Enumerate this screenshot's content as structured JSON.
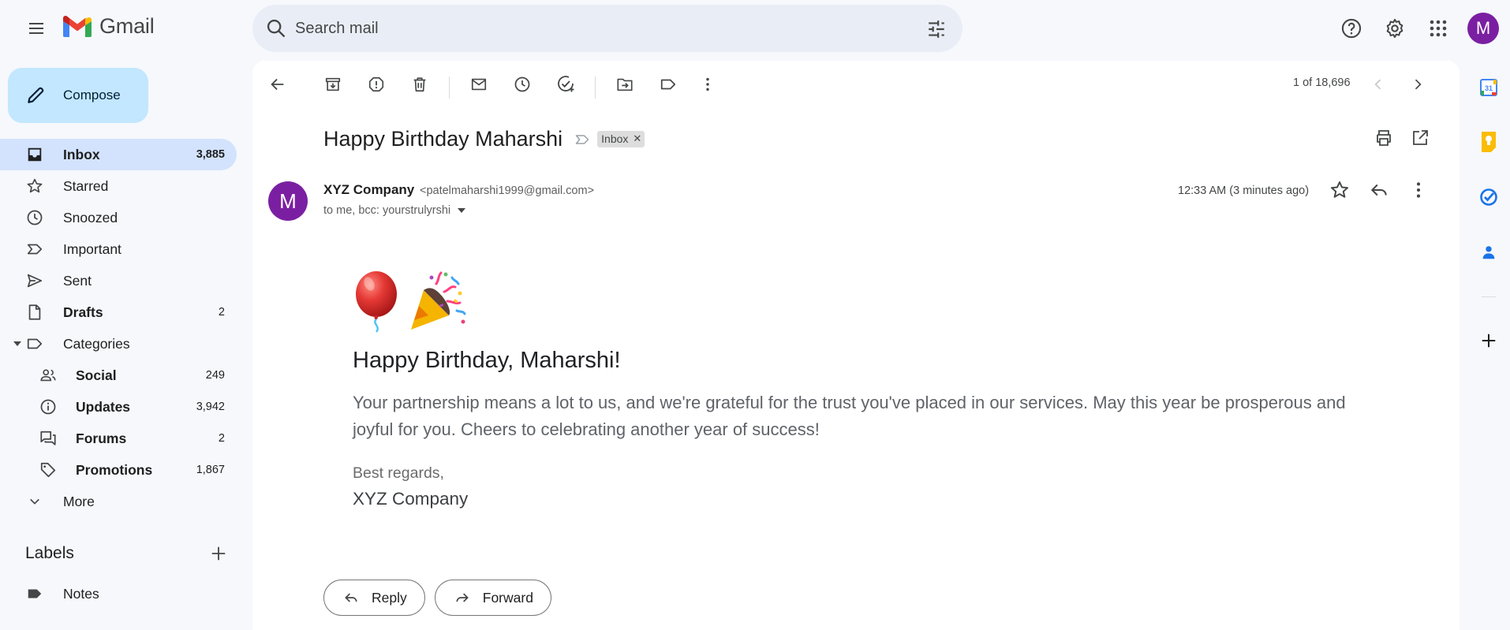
{
  "app": {
    "name": "Gmail"
  },
  "search": {
    "placeholder": "Search mail"
  },
  "account": {
    "initial": "M"
  },
  "compose": {
    "label": "Compose"
  },
  "nav": [
    {
      "id": "inbox",
      "label": "Inbox",
      "count": "3,885",
      "icon": "inbox-icon"
    },
    {
      "id": "starred",
      "label": "Starred",
      "count": "",
      "icon": "star-icon"
    },
    {
      "id": "snoozed",
      "label": "Snoozed",
      "count": "",
      "icon": "clock-icon"
    },
    {
      "id": "important",
      "label": "Important",
      "count": "",
      "icon": "important-icon"
    },
    {
      "id": "sent",
      "label": "Sent",
      "count": "",
      "icon": "send-icon"
    },
    {
      "id": "drafts",
      "label": "Drafts",
      "count": "2",
      "icon": "draft-icon"
    },
    {
      "id": "categories",
      "label": "Categories",
      "count": "",
      "icon": "label-icon"
    },
    {
      "id": "social",
      "label": "Social",
      "count": "249",
      "icon": "people-icon"
    },
    {
      "id": "updates",
      "label": "Updates",
      "count": "3,942",
      "icon": "info-icon"
    },
    {
      "id": "forums",
      "label": "Forums",
      "count": "2",
      "icon": "forum-icon"
    },
    {
      "id": "promotions",
      "label": "Promotions",
      "count": "1,867",
      "icon": "tag-icon"
    },
    {
      "id": "more",
      "label": "More",
      "count": "",
      "icon": "chevron-down-icon"
    }
  ],
  "labels": {
    "heading": "Labels",
    "items": [
      {
        "label": "Notes"
      }
    ]
  },
  "toolbar": {
    "pager": "1 of 18,696"
  },
  "message": {
    "subject": "Happy Birthday Maharshi",
    "chip": "Inbox",
    "sender_initial": "M",
    "sender_name": "XYZ Company",
    "sender_email": "<patelmaharshi1999@gmail.com>",
    "recipients": "to me, bcc: yourstrulyrshi",
    "time": "12:33 AM (3 minutes ago)",
    "emoji": [
      "balloon",
      "party-popper"
    ],
    "greeting": "Happy Birthday, Maharshi!",
    "paragraph": "Your partnership means a lot to us, and we're grateful for the trust you've placed in our services. May this year be prosperous and joyful for you. Cheers to celebrating another year of success!",
    "regards": "Best regards,",
    "signature": "XYZ Company"
  },
  "actions": {
    "reply": "Reply",
    "forward": "Forward"
  },
  "side_panel": {
    "calendar_date": "31"
  },
  "colors": {
    "accent": "#0b57d0",
    "compose_bg": "#c2e7ff",
    "active_nav": "#d3e3fd",
    "avatar": "#7b1fa2"
  }
}
